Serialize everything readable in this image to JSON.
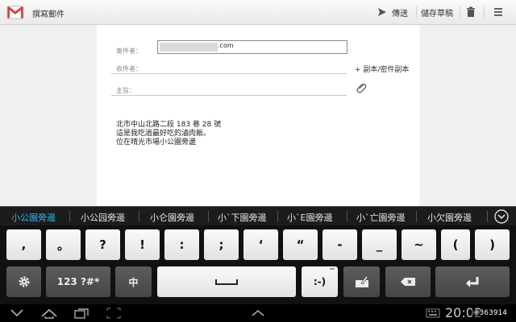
{
  "actionbar": {
    "title": "撰寫郵件",
    "send_label": "傳送",
    "save_draft_label": "儲存草稿",
    "colors": {
      "gmail_red": "#d44638"
    }
  },
  "compose": {
    "from_label": "寄件者：",
    "from_value_suffix": ".com",
    "to_label": "收件者：",
    "subject_label": "主旨：",
    "cc_bcc_label": "+ 副本/密件副本",
    "body_lines": [
      "北市中山北路二段 183 巷 28 號",
      "這是我吃過最好吃的滷肉飯。",
      "位在晴光市場小公園旁邊"
    ]
  },
  "suggestions": [
    "小公園旁邊",
    "小公园旁邊",
    "小仑園旁邊",
    "小ˋ下園旁邊",
    "小ˋE園旁邊",
    "小ˋ亡園旁邊",
    "小欠園旁邊"
  ],
  "keyboard": {
    "row1": [
      ",",
      "。",
      "?",
      "!",
      ":",
      ";",
      "‘",
      "“",
      "-",
      "_",
      "~",
      "(",
      ")"
    ],
    "row2": {
      "symbols_label": "123 ?#*",
      "lang_label": "中",
      "smiley_label": ":-)"
    },
    "icons": [
      "gear-icon",
      "space-icon",
      "handwriting-icon",
      "backspace-icon",
      "enter-icon"
    ]
  },
  "status": {
    "clock": "20:02"
  },
  "watermark": "#363914"
}
